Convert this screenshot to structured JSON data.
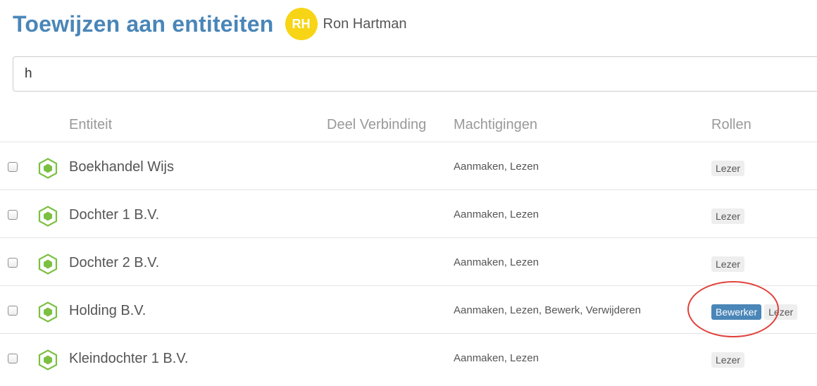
{
  "header": {
    "title": "Toewijzen aan entiteiten",
    "avatar_initials": "RH",
    "avatar_color": "#f7d516",
    "user_name": "Ron Hartman",
    "title_color": "#4a86b8"
  },
  "search": {
    "value": "h",
    "placeholder": ""
  },
  "table": {
    "columns": {
      "entity": "Entiteit",
      "share": "Deel Verbinding",
      "permissions": "Machtigingen",
      "roles": "Rollen"
    },
    "entity_icon": "hexagon-icon",
    "entity_icon_color": "#7ac143",
    "rows": [
      {
        "name": "Boekhandel Wijs",
        "checked": false,
        "permissions": "Aanmaken, Lezen",
        "roles": [
          "Lezer"
        ]
      },
      {
        "name": "Dochter 1 B.V.",
        "checked": false,
        "permissions": "Aanmaken, Lezen",
        "roles": [
          "Lezer"
        ]
      },
      {
        "name": "Dochter 2 B.V.",
        "checked": false,
        "permissions": "Aanmaken, Lezen",
        "roles": [
          "Lezer"
        ]
      },
      {
        "name": "Holding B.V.",
        "checked": false,
        "permissions": "Aanmaken, Lezen, Bewerk, Verwijderen",
        "roles": [
          "Bewerker",
          "Lezer"
        ],
        "highlighted_role": "Bewerker"
      },
      {
        "name": "Kleindochter 1 B.V.",
        "checked": false,
        "permissions": "Aanmaken, Lezen",
        "roles": [
          "Lezer"
        ]
      }
    ]
  },
  "colors": {
    "primary_badge": "#4a86b8",
    "default_badge": "#eeeeee",
    "annotation_ring": "#e0403a"
  }
}
